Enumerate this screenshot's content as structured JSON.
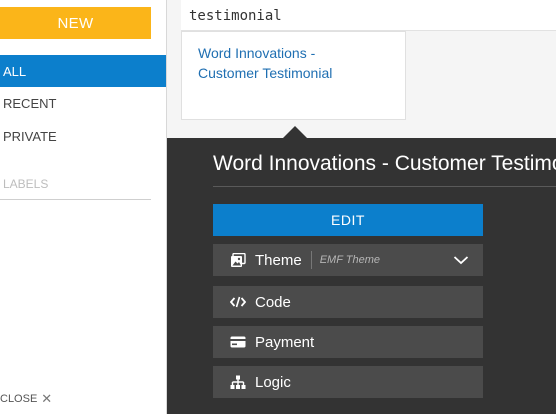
{
  "sidebar": {
    "new_label": "NEW",
    "items": [
      {
        "label": "ALL",
        "active": true
      },
      {
        "label": "RECENT",
        "active": false
      },
      {
        "label": "PRIVATE",
        "active": false
      }
    ],
    "labels_heading": "LABELS",
    "close_label": "CLOSE"
  },
  "search": {
    "value": "testimonial"
  },
  "results": [
    {
      "title": "Word Innovations - Customer Testimonial"
    }
  ],
  "panel": {
    "title": "Word Innovations - Customer Testimonial",
    "edit_label": "EDIT",
    "theme_label": "Theme",
    "theme_value": "EMF Theme",
    "code_label": "Code",
    "payment_label": "Payment",
    "logic_label": "Logic"
  },
  "colors": {
    "accent_blue": "#0c7fcc",
    "new_button": "#fbb519",
    "panel_bg": "#333333",
    "row_bg": "#4b4b4b",
    "link": "#1f6fb2"
  },
  "icons": {
    "theme": "image-icon",
    "code": "code-icon",
    "payment": "credit-card-icon",
    "logic": "sitemap-icon",
    "dropdown": "chevron-down-icon",
    "close": "close-icon"
  }
}
